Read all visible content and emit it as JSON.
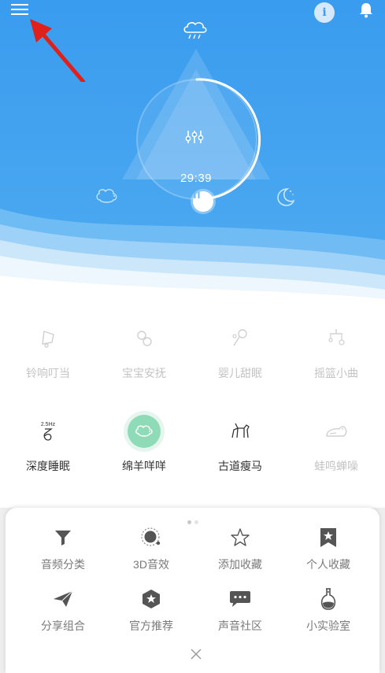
{
  "player": {
    "timer": "29:39",
    "weather_icon": "rain-cloud-icon",
    "mode_icon": "equalizer-icon",
    "play_state": "paused",
    "colors": {
      "sky_top": "#3e9ff0",
      "sky_mid": "#4aa6ee",
      "accent": "#ffffff"
    }
  },
  "header": {
    "menu_icon": "hamburger-menu-icon",
    "info_icon": "info-icon",
    "bell_icon": "bell-icon"
  },
  "sounds": [
    {
      "label": "铃响叮当",
      "icon": "bell-ring-icon",
      "active": false
    },
    {
      "label": "宝宝安抚",
      "icon": "pacifier-icon",
      "active": false
    },
    {
      "label": "婴儿甜眠",
      "icon": "rattle-icon",
      "active": false
    },
    {
      "label": "摇篮小曲",
      "icon": "crib-mobile-icon",
      "active": false
    },
    {
      "label": "深度睡眠",
      "icon": "deep-sleep-icon",
      "active": true,
      "badge": "2.5Hz"
    },
    {
      "label": "绵羊咩咩",
      "icon": "sheep-icon",
      "active": true,
      "selected": true
    },
    {
      "label": "古道瘦马",
      "icon": "horse-icon",
      "active": true
    },
    {
      "label": "蛙鸣蝉噪",
      "icon": "frog-icon",
      "active": false
    }
  ],
  "menu": {
    "items": [
      {
        "label": "音频分类",
        "icon": "filter-icon"
      },
      {
        "label": "3D音效",
        "icon": "3d-sound-icon"
      },
      {
        "label": "添加收藏",
        "icon": "star-outline-icon"
      },
      {
        "label": "个人收藏",
        "icon": "bookmark-star-icon"
      },
      {
        "label": "分享组合",
        "icon": "paper-plane-icon"
      },
      {
        "label": "官方推荐",
        "icon": "hexagon-star-icon"
      },
      {
        "label": "声音社区",
        "icon": "chat-bubble-icon"
      },
      {
        "label": "小实验室",
        "icon": "flask-icon"
      }
    ],
    "page_indicator": {
      "current": 1,
      "total": 2
    }
  }
}
